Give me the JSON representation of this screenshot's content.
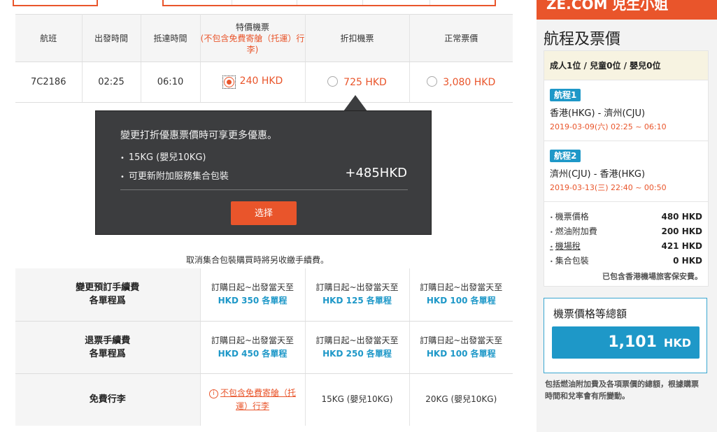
{
  "brand": {
    "text": "ZE.COM 児生小姐"
  },
  "fare_table": {
    "headers": {
      "flight": "航班",
      "depart": "出發時間",
      "arrive": "抵達時間",
      "special_title": "特價機票",
      "special_sub": "(不包含免費寄艙（托運）行李)",
      "discount": "折扣機票",
      "normal": "正常票價"
    },
    "row": {
      "flight": "7C2186",
      "depart": "02:25",
      "arrive": "06:10",
      "special_price": "240 HKD",
      "discount_price": "725 HKD",
      "normal_price": "3,080 HKD"
    }
  },
  "popup": {
    "title": "變更打折優惠票價時可享更多優惠。",
    "items": [
      "15KG (嬰兒10KG)",
      "可更新附加服務集合包裝"
    ],
    "extra": "+485HKD",
    "button": "选择"
  },
  "cancel_note": "取消集合包裝購買時將另收繳手續費。",
  "fee_table": {
    "rows": [
      {
        "label_1": "變更預訂手續費",
        "label_2": "各單程爲",
        "cells": [
          {
            "line1": "訂購日起~出發當天至",
            "line2": "HKD 350 各單程"
          },
          {
            "line1": "訂購日起~出發當天至",
            "line2": "HKD 125 各單程"
          },
          {
            "line1": "訂購日起~出發當天至",
            "line2": "HKD 100 各單程"
          }
        ]
      },
      {
        "label_1": "退票手續費",
        "label_2": "各單程爲",
        "cells": [
          {
            "line1": "訂購日起~出發當天至",
            "line2": "HKD 450 各單程"
          },
          {
            "line1": "訂購日起~出發當天至",
            "line2": "HKD 250 各單程"
          },
          {
            "line1": "訂購日起~出發當天至",
            "line2": "HKD 100 各單程"
          }
        ]
      }
    ],
    "baggage": {
      "label": "免費行李",
      "special_1": "不包含免費寄艙（托",
      "special_2": "運）行李",
      "discount": "15KG (嬰兒10KG)",
      "normal": "20KG (嬰兒10KG)"
    }
  },
  "panel": {
    "title": "航程及票價",
    "pax": "成人1位 / 兒童0位 / 嬰兒0位",
    "trips": [
      {
        "badge": "航程1",
        "route": "香港(HKG) - 濟州(CJU)",
        "time": "2019-03-09(六) 02:25 ~ 06:10"
      },
      {
        "badge": "航程2",
        "route": "濟州(CJU) - 香港(HKG)",
        "time": "2019-03-13(三) 22:40 ~ 00:50"
      }
    ],
    "costs": [
      {
        "label": "機票價格",
        "value": "480 HKD"
      },
      {
        "label": "燃油附加費",
        "value": "200 HKD"
      },
      {
        "label": "機場稅",
        "value": "421 HKD"
      },
      {
        "label": "集合包裝",
        "value": "0 HKD"
      }
    ],
    "tax_note": "已包含香港機場旅客保安費。",
    "total_label": "機票價格等總額",
    "total_value": "1,101",
    "total_currency": "HKD",
    "bottom_note": "包括燃油附加費及各項票價的總額，根據購票時間和兌率會有所變動。"
  },
  "colors": {
    "accent": "#e9552b",
    "blue": "#1e98c8",
    "popup_bg": "#3c3d3f"
  }
}
